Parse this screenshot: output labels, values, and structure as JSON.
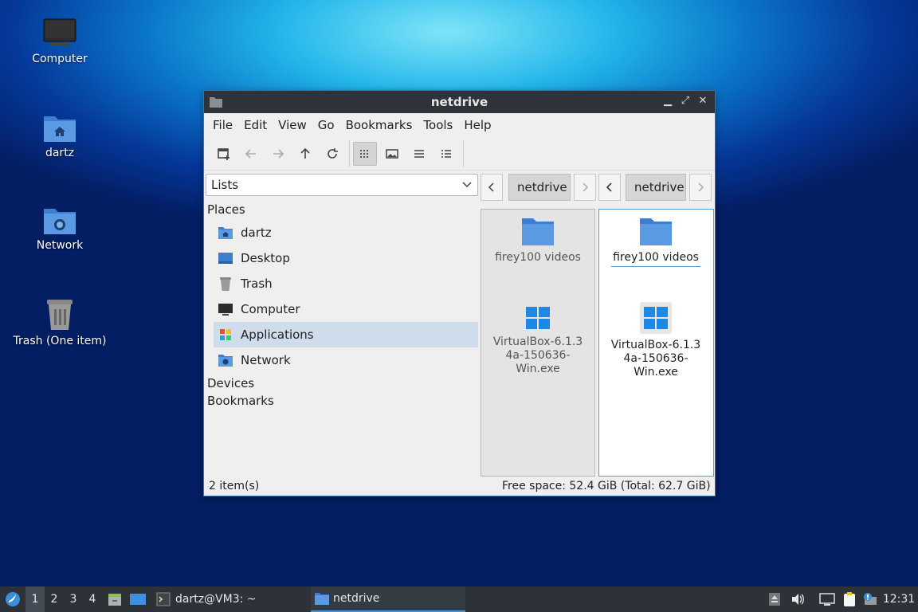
{
  "desktop": {
    "icons": [
      {
        "label": "Computer",
        "icon": "computer-icon"
      },
      {
        "label": "dartz",
        "icon": "home-folder-icon"
      },
      {
        "label": "Network",
        "icon": "network-folder-icon"
      },
      {
        "label": "Trash (One item)",
        "icon": "trash-full-icon"
      }
    ]
  },
  "window": {
    "title": "netdrive",
    "controls": [
      "minimize",
      "maximize",
      "close"
    ],
    "menu": [
      "File",
      "Edit",
      "View",
      "Go",
      "Bookmarks",
      "Tools",
      "Help"
    ],
    "toolbar": [
      "new-window-icon",
      "back-icon",
      "forward-icon",
      "up-icon",
      "reload-icon",
      "icon-view-icon",
      "thumbnail-view-icon",
      "compact-view-icon",
      "detailed-list-icon"
    ],
    "sidebar": {
      "selector": "Lists",
      "places_header": "Places",
      "places": [
        {
          "label": "dartz",
          "icon": "home-folder-icon"
        },
        {
          "label": "Desktop",
          "icon": "desktop-icon"
        },
        {
          "label": "Trash",
          "icon": "trash-icon"
        },
        {
          "label": "Computer",
          "icon": "computer-icon"
        },
        {
          "label": "Applications",
          "icon": "applications-icon",
          "selected": true
        },
        {
          "label": "Network",
          "icon": "network-icon"
        }
      ],
      "devices_header": "Devices",
      "bookmarks_header": "Bookmarks"
    },
    "panes": [
      {
        "crumb": "netdrive",
        "files": [
          {
            "name": "firey100 videos",
            "type": "folder"
          },
          {
            "name": "VirtualBox-6.1.34a-150636-Win.exe",
            "lines": [
              "VirtualBox-6.1.3",
              "4a-150636-",
              "Win.exe"
            ],
            "type": "exe"
          }
        ]
      },
      {
        "crumb": "netdrive",
        "files": [
          {
            "name": "firey100 videos",
            "type": "folder"
          },
          {
            "name": "VirtualBox-6.1.34a-150636-Win.exe",
            "lines": [
              "VirtualBox-6.1.3",
              "4a-150636-",
              "Win.exe"
            ],
            "type": "exe"
          }
        ]
      }
    ],
    "status_left": "2 item(s)",
    "status_right": "Free space: 52.4 GiB (Total: 62.7 GiB)"
  },
  "taskbar": {
    "workspaces": [
      "1",
      "2",
      "3",
      "4"
    ],
    "tasks": [
      {
        "label": "dartz@VM3: ~",
        "icon": "terminal-icon"
      },
      {
        "label": "netdrive",
        "icon": "folder-icon",
        "active": true
      }
    ],
    "clock": "12:31"
  },
  "colors": {
    "accent": "#4a90d9",
    "folder_blue": "#4a8fd8",
    "panel_dark": "#2d3238"
  }
}
